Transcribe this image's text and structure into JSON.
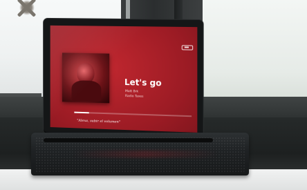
{
  "screen": {
    "song_title": "Let's go",
    "artist": "Matt Brk",
    "station": "Radio Taxes",
    "prompt": "\"Alexa, subir el volumen\"",
    "progress": 0.13,
    "accent_color": "#b0212a"
  },
  "icons": {
    "brand": "amazon-logo-icon",
    "album_art": "album-art-image"
  }
}
